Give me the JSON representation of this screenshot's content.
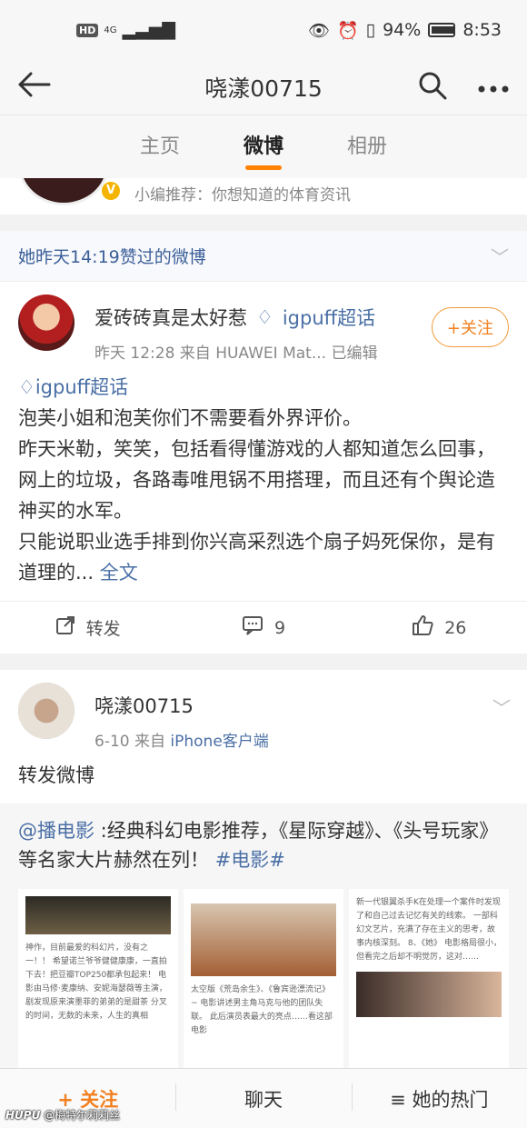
{
  "status_bar": {
    "hd": "HD",
    "signal": "4G",
    "battery": "94%",
    "time": "8:53"
  },
  "nav": {
    "title": "哓漾00715"
  },
  "tabs": [
    {
      "label": "主页"
    },
    {
      "label": "微博"
    },
    {
      "label": "相册"
    }
  ],
  "recommend": {
    "badge": "V",
    "text": "小编推荐：你想知道的体育资讯"
  },
  "liked_header": {
    "text": "她昨天14:19赞过的微博"
  },
  "post1": {
    "author": "爱砖砖真是太好惹",
    "topic": "igpuff超话",
    "meta": "昨天 12:28  来自 HUAWEI Mat...   已编辑",
    "follow_label": "+关注",
    "topic_line": "igpuff超话",
    "lines": [
      "泡芙小姐和泡芙你们不需要看外界评价。",
      "昨天米勒，笑笑，包括看得懂游戏的人都知道怎么回事，网上的垃圾，各路毒唯甩锅不用搭理，而且还有个舆论造神买的水军。",
      "只能说职业选手排到你兴高采烈选个扇子妈死保你，是有道理的... "
    ],
    "full_link": "全文",
    "repost": "转发",
    "comments": "9",
    "likes": "26"
  },
  "post2": {
    "author": "哓漾00715",
    "meta_time": "6-10  来自 ",
    "meta_source": "iPhone客户端",
    "body": "转发微博",
    "repost_user": "@播电影",
    "repost_text": " :经典科幻电影推荐，《星际穿越》、《头号玩家》等名家大片赫然在列！ ",
    "repost_tag": "#电影#",
    "thumb1": "神作，目前最爱的科幻片，没有之一！！ 希望诺兰爷爷健健康康，一直拍下去！把豆瓣TOP250都承包起来！ 电影由马修·麦康纳、安妮海瑟薇等主演，剧发现原来演墨菲的弟弟的是甜茶 分叉的时间，无数的未来，人生的真相",
    "thumb2": "太空版《荒岛余生》、《鲁宾逊漂流记》~ 电影讲述男主角马克与他的团队失联。 此后演员表最大的亮点……看这部电影",
    "thumb3": "新一代银翼杀手K在处理一个案件时发现了和自己过去记忆有关的线索。 一部科幻文艺片，充满了存在主义的思考，故事内核深刻。 8、《她》 电影格局很小，但看完之后却不明觉厉，这对……"
  },
  "bottom_bar": {
    "follow": "+ 关注",
    "chat": "聊天",
    "hot": "≡ 她的热门"
  },
  "watermark": {
    "brand": "HUPU",
    "user": "@梅特尔莉莉丝"
  }
}
